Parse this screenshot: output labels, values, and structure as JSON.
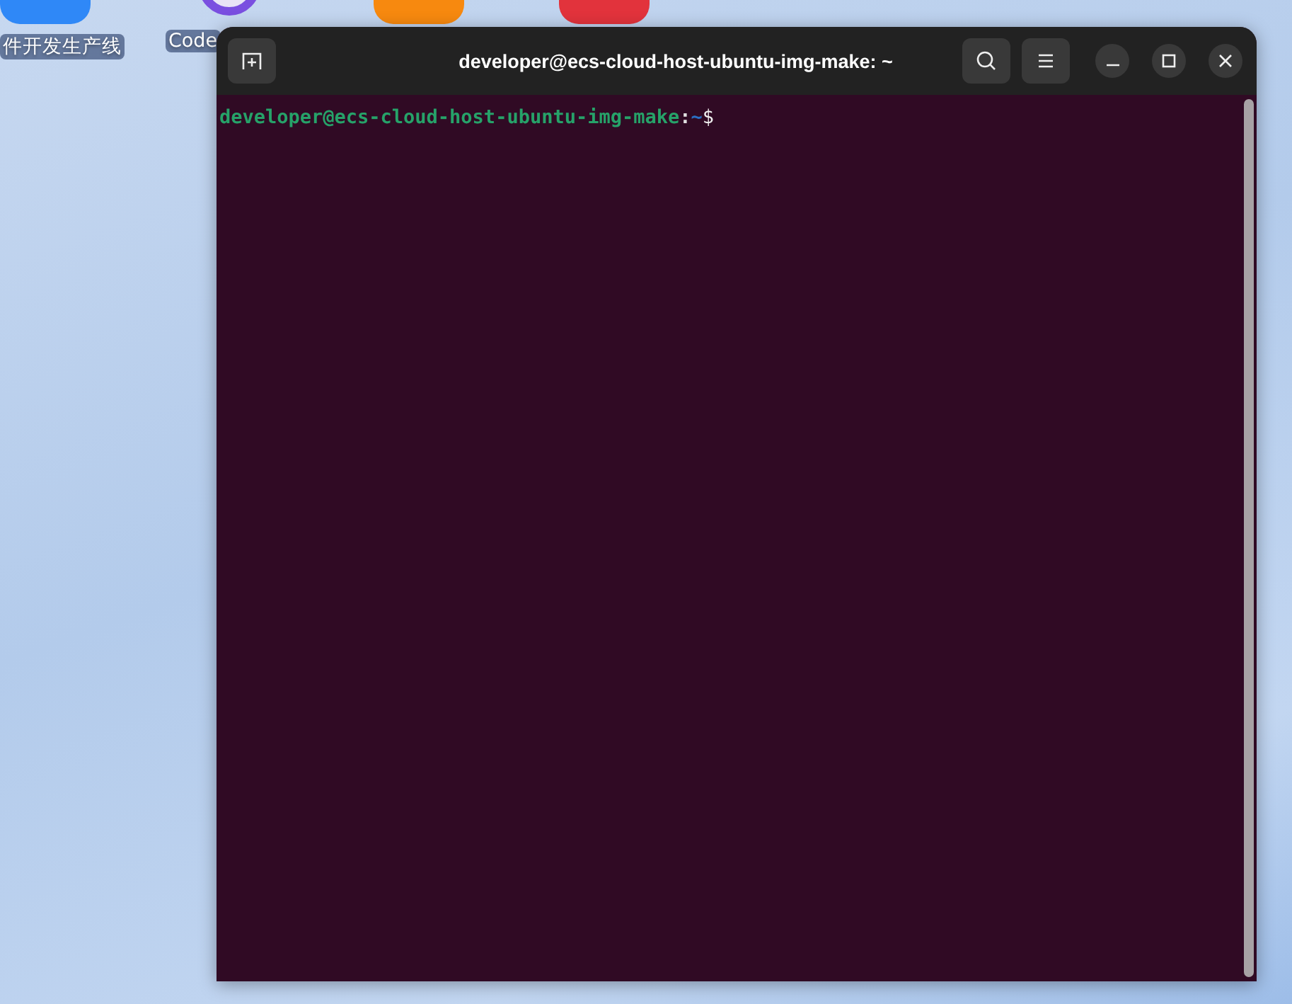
{
  "desktop": {
    "icons": [
      {
        "kind": "tile",
        "color": "#2f88f7",
        "label": "件开发生产线"
      },
      {
        "kind": "orb",
        "color": "#7a4fe0",
        "label": "Code"
      },
      {
        "kind": "tile",
        "color": "#f7890f"
      },
      {
        "kind": "tile",
        "color": "#e2333c"
      }
    ]
  },
  "window": {
    "title": "developer@ecs-cloud-host-ubuntu-img-make: ~"
  },
  "terminal": {
    "prompt": {
      "user_host": "developer@ecs-cloud-host-ubuntu-img-make",
      "separator": ":",
      "path": "~",
      "symbol": "$"
    }
  }
}
